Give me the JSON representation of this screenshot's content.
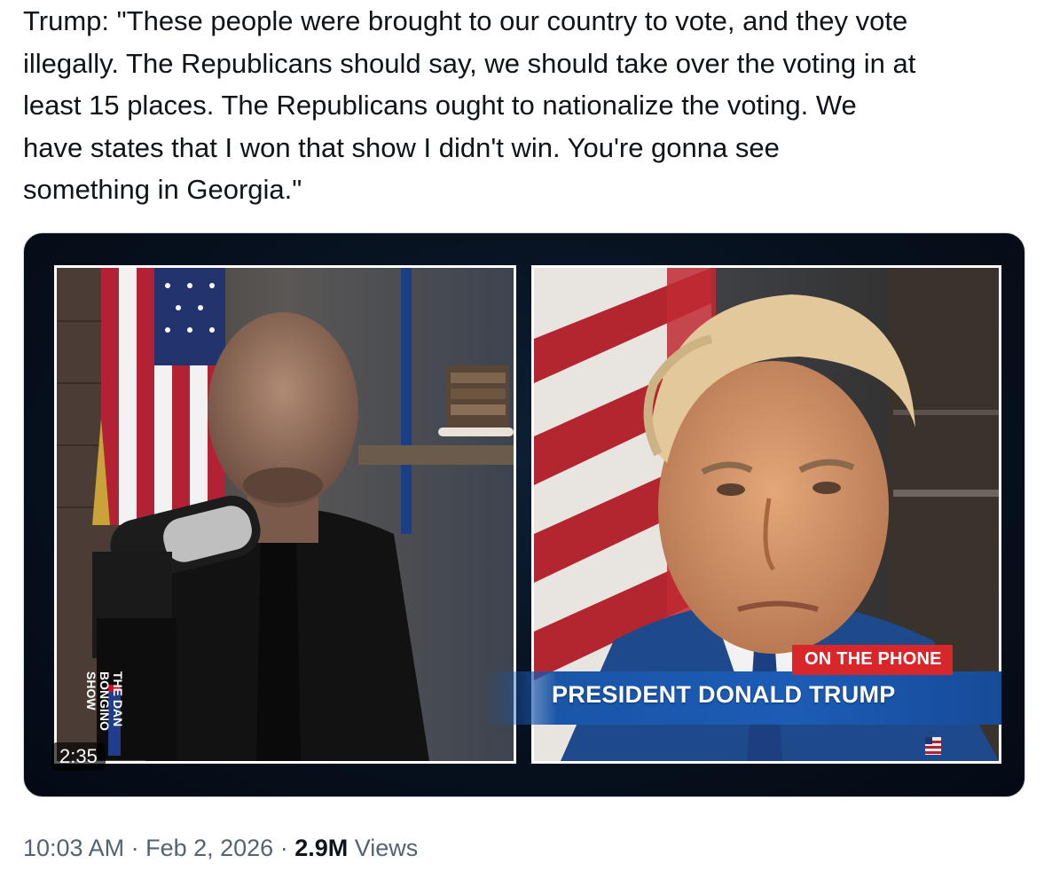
{
  "tweet": {
    "text": "Trump: \"These people were brought to our country to vote, and they vote\nillegally. The Republicans should say, we should take over the voting in at\nleast 15 places. The Republicans ought to nationalize the voting. We\nhave states that I won that show I didn't win. You're gonna see\nsomething in Georgia.\""
  },
  "video": {
    "duration": "2:35",
    "badge": "ON THE PHONE",
    "name_banner": "PRESIDENT DONALD TRUMP",
    "mic_flag_text": "THE DAN BONGINO SHOW"
  },
  "meta": {
    "time": "10:03 AM",
    "separator": " · ",
    "date": "Feb 2, 2026",
    "views_count": "2.9M",
    "views_label": " Views"
  },
  "colors": {
    "accent_red": "#d8262a",
    "banner_blue": "#1c5cb6",
    "text_primary": "#0f1419",
    "text_secondary": "#536471"
  }
}
